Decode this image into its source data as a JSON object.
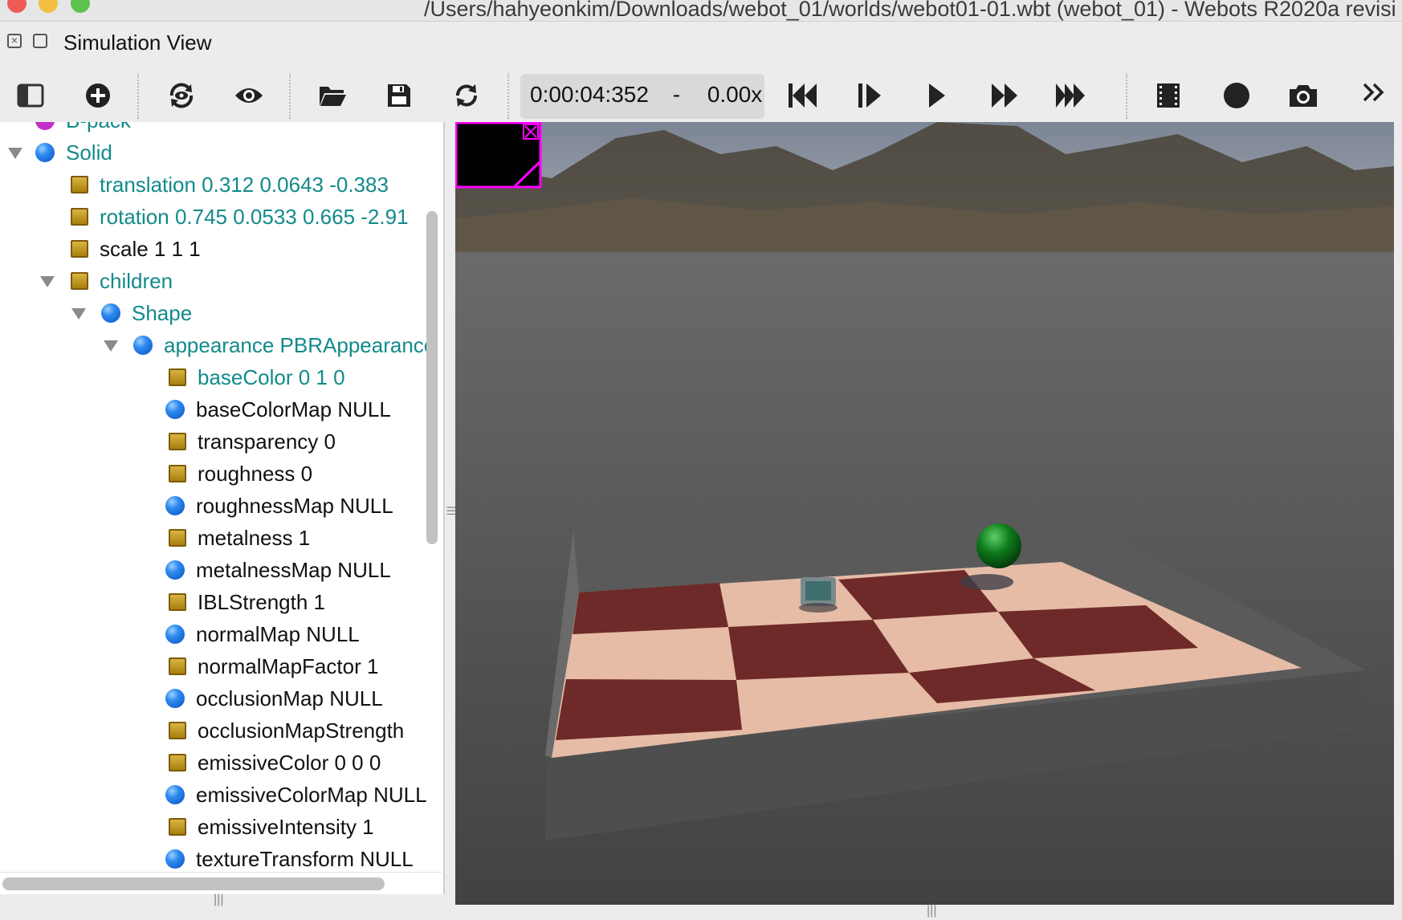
{
  "window": {
    "title": "/Users/hahyeonkim/Downloads/webot_01/worlds/webot01-01.wbt (webot_01) - Webots R2020a revisi"
  },
  "panel": {
    "title": "Simulation View"
  },
  "toolbar": {
    "buttons": [
      {
        "name": "show-scene-tree",
        "icon": "sidebar-panel-icon"
      },
      {
        "name": "add-node",
        "icon": "add-circle-icon"
      },
      {
        "name": "reset-viewpoint",
        "icon": "viewpoint-rotate-icon"
      },
      {
        "name": "view-options",
        "icon": "eye-icon"
      },
      {
        "name": "open-world",
        "icon": "folder-open-icon"
      },
      {
        "name": "save-world",
        "icon": "floppy-disk-icon"
      },
      {
        "name": "reload-world",
        "icon": "reload-icon"
      },
      {
        "name": "reset-simulation",
        "icon": "skip-to-start-icon"
      },
      {
        "name": "step",
        "icon": "step-forward-icon"
      },
      {
        "name": "run-realtime",
        "icon": "play-icon"
      },
      {
        "name": "run-fast",
        "icon": "fast-forward-icon"
      },
      {
        "name": "run-fastest",
        "icon": "fastest-forward-icon"
      },
      {
        "name": "make-movie",
        "icon": "film-strip-icon"
      },
      {
        "name": "record-animation",
        "icon": "record-icon"
      },
      {
        "name": "take-screenshot",
        "icon": "camera-icon"
      },
      {
        "name": "more-tools",
        "icon": "chevron-double-right-icon"
      }
    ],
    "time": "0:00:04:352",
    "separator": "-",
    "speed": "0.00x"
  },
  "tree": {
    "partial_top_label": "B-pack",
    "rows": [
      {
        "label": "Solid",
        "icon": "sphere-node-icon",
        "color": "teal",
        "expanded": true
      },
      {
        "label": "translation 0.312 0.0643 -0.383",
        "icon": "field-icon",
        "color": "teal"
      },
      {
        "label": "rotation 0.745 0.0533 0.665 -2.91",
        "icon": "field-icon",
        "color": "teal"
      },
      {
        "label": "scale 1 1 1",
        "icon": "field-icon",
        "color": "dark"
      },
      {
        "label": "children",
        "icon": "field-icon",
        "color": "teal",
        "expanded": true
      },
      {
        "label": "Shape",
        "icon": "sphere-node-icon",
        "color": "teal",
        "expanded": true
      },
      {
        "label": "appearance PBRAppearance",
        "icon": "sphere-node-icon",
        "color": "teal",
        "expanded": true
      },
      {
        "label": "baseColor 0 1 0",
        "icon": "field-icon",
        "color": "teal"
      },
      {
        "label": "baseColorMap NULL",
        "icon": "sphere-node-icon",
        "color": "dark"
      },
      {
        "label": "transparency 0",
        "icon": "field-icon",
        "color": "dark"
      },
      {
        "label": "roughness 0",
        "icon": "field-icon",
        "color": "dark"
      },
      {
        "label": "roughnessMap NULL",
        "icon": "sphere-node-icon",
        "color": "dark"
      },
      {
        "label": "metalness 1",
        "icon": "field-icon",
        "color": "dark"
      },
      {
        "label": "metalnessMap NULL",
        "icon": "sphere-node-icon",
        "color": "dark"
      },
      {
        "label": "IBLStrength 1",
        "icon": "field-icon",
        "color": "dark"
      },
      {
        "label": "normalMap NULL",
        "icon": "sphere-node-icon",
        "color": "dark"
      },
      {
        "label": "normalMapFactor 1",
        "icon": "field-icon",
        "color": "dark"
      },
      {
        "label": "occlusionMap NULL",
        "icon": "sphere-node-icon",
        "color": "dark"
      },
      {
        "label": "occlusionMapStrength",
        "icon": "field-icon",
        "color": "dark"
      },
      {
        "label": "emissiveColor 0 0 0",
        "icon": "field-icon",
        "color": "dark"
      },
      {
        "label": "emissiveColorMap NULL",
        "icon": "sphere-node-icon",
        "color": "dark"
      },
      {
        "label": "emissiveIntensity 1",
        "icon": "field-icon",
        "color": "dark"
      },
      {
        "label": "textureTransform NULL",
        "icon": "sphere-node-icon",
        "color": "dark"
      }
    ]
  },
  "scene": {
    "objects": [
      "arena",
      "e-puck-robot",
      "green-ball"
    ],
    "colors": {
      "floor": "#555555",
      "wall": "#5e5e5e",
      "tile_dark": "#6e2a28",
      "tile_light": "#e6bca6",
      "ball": "#0e7a1a",
      "overlay_border": "#ff00ff"
    }
  }
}
